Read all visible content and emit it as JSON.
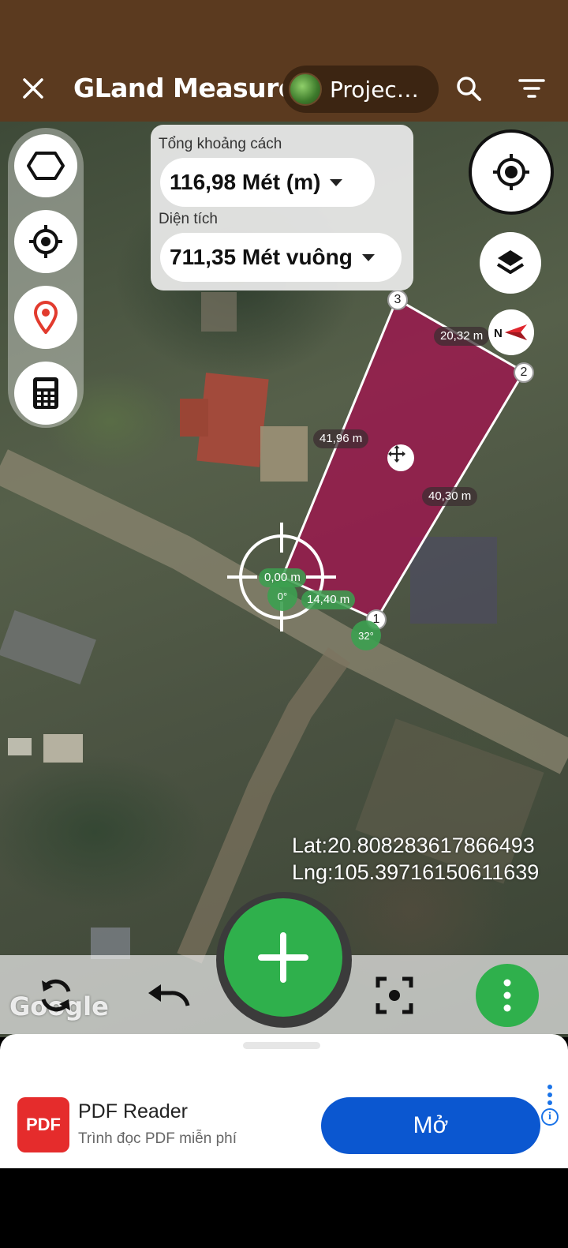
{
  "app": {
    "title": "GLand Measure",
    "project_label": "Project..."
  },
  "measure": {
    "distance_label": "Tổng khoảng cách",
    "distance_value": "116,98 Mét (m)",
    "area_label": "Diện tích",
    "area_value": "711,35 Mét vuông"
  },
  "map": {
    "vertices": [
      "1",
      "2",
      "3"
    ],
    "edges": [
      "20,32 m",
      "41,96 m",
      "40,30 m",
      "14,40 m",
      "0,00 m"
    ],
    "angles": [
      "0°",
      "32°"
    ],
    "lat": "Lat:20.808283617866493",
    "lng": "Lng:105.39716150611639",
    "google_logo": "Google",
    "polygon_color": "#a0134e"
  },
  "icons": {
    "close": "close-icon",
    "search": "search-icon",
    "filter": "filter-icon",
    "shape": "hexagon-icon",
    "locate": "crosshair-icon",
    "pin": "map-pin-icon",
    "calc": "calculator-icon",
    "gps": "gps-target-icon",
    "layers": "layers-icon",
    "compass": "compass-icon",
    "refresh": "refresh-icon",
    "undo": "undo-icon",
    "add": "plus-icon",
    "focus": "focus-icon",
    "more": "more-vert-icon"
  },
  "ad": {
    "icon_text": "PDF",
    "title": "PDF Reader",
    "subtitle": "Trình đọc PDF miễn phí",
    "cta": "Mở",
    "info": "i"
  },
  "colors": {
    "header": "#5b3a1f",
    "accent_green": "#2fb04c",
    "ad_button": "#0b57d0"
  }
}
